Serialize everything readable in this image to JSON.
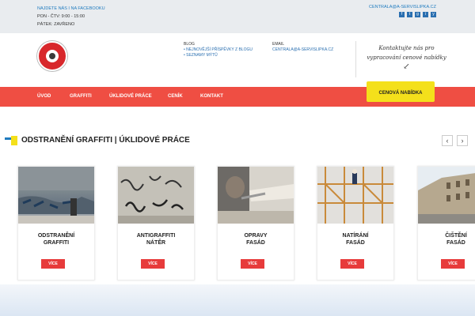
{
  "topbar": {
    "facebook": "NAJDETE NÁS I NA FACEBOOKU",
    "hours1": "PON - ČTV: 9:00 - 15:00",
    "hours2": "PÁTEK: ZAVŘENO",
    "email": "CENTRALA@A-SERVISLIPKA.CZ",
    "socials": [
      "f",
      "t",
      "g",
      "i",
      "y"
    ]
  },
  "header": {
    "blog_heading": "BLOG",
    "blog_link1": "• NEJNOVĚJŠÍ PŘÍSPĚVKY Z BLOGU",
    "blog_link2": "• SEZNAMY MÝTŮ",
    "email_heading": "EMAIL",
    "email_value": "CENTRALA@A-SERVISLIPKA.CZ",
    "tagline_line1": "Kontaktujte nás pro",
    "tagline_line2": "vypracování cenové nabídky",
    "tagline_arrow": "↙"
  },
  "nav": {
    "items": [
      "ÚVOD",
      "GRAFFITI",
      "ÚKLIDOVÉ PRÁCE",
      "CENÍK",
      "KONTAKT"
    ],
    "cta": "CENOVÁ NABÍDKA"
  },
  "section": {
    "title": "ODSTRANĚNÍ GRAFFITI | ÚKLIDOVÉ PRÁCE",
    "prev": "‹",
    "next": "›"
  },
  "cards": [
    {
      "title": "ODSTRANĚNÍ\nGRAFFITI",
      "button": "VÍCE"
    },
    {
      "title": "ANTIGRAFFITI\nNÁTĚR",
      "button": "VÍCE"
    },
    {
      "title": "OPRAVY\nFASÁD",
      "button": "VÍCE"
    },
    {
      "title": "NATÍRÁNÍ\nFASÁD",
      "button": "VÍCE"
    },
    {
      "title": "ČIŠTĚNÍ\nFASÁD",
      "button": "VÍCE"
    }
  ],
  "colors": {
    "nav_red": "#ef4e43",
    "cta_yellow": "#f4e01b",
    "link_blue": "#1f7bbf",
    "button_red": "#e73b3b"
  }
}
